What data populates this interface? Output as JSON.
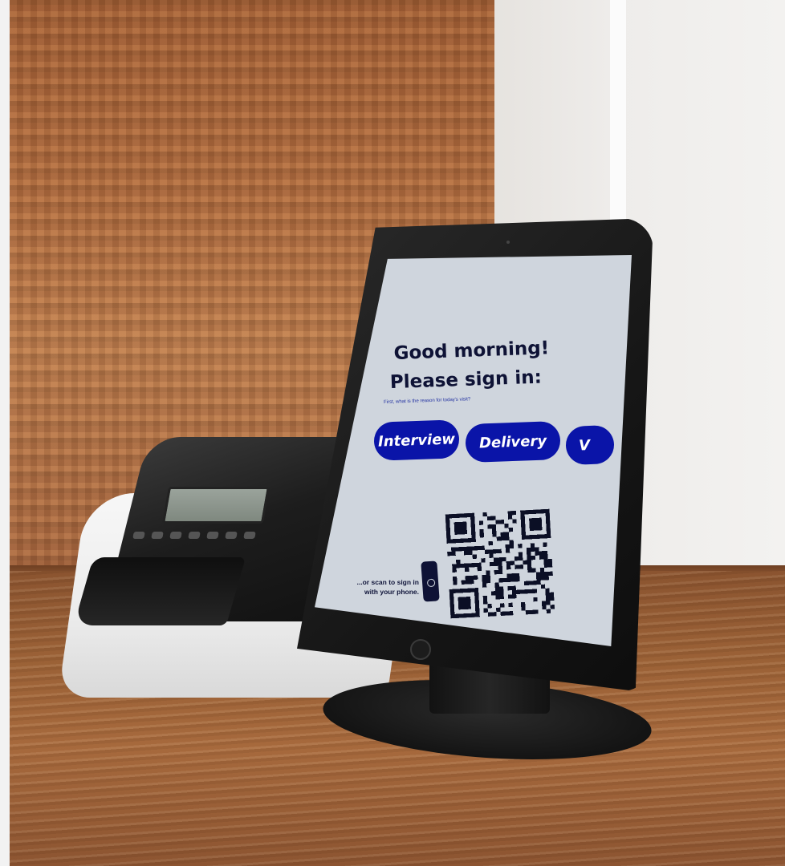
{
  "kiosk": {
    "greeting_line1": "Good morning!",
    "greeting_line2": "Please sign in:",
    "subtitle": "First, what is the reason for today's visit?",
    "reasons": [
      {
        "label": "Interview"
      },
      {
        "label": "Delivery"
      },
      {
        "label": "V"
      }
    ],
    "scan_text_line1": "...or scan to sign in",
    "scan_text_line2": "with your phone.",
    "accent_color": "#0a14a8",
    "text_color": "#0e1235",
    "screen_color": "#cfd5dd"
  },
  "icons": {
    "phone": "phone-icon",
    "qr": "qr-code-icon"
  }
}
